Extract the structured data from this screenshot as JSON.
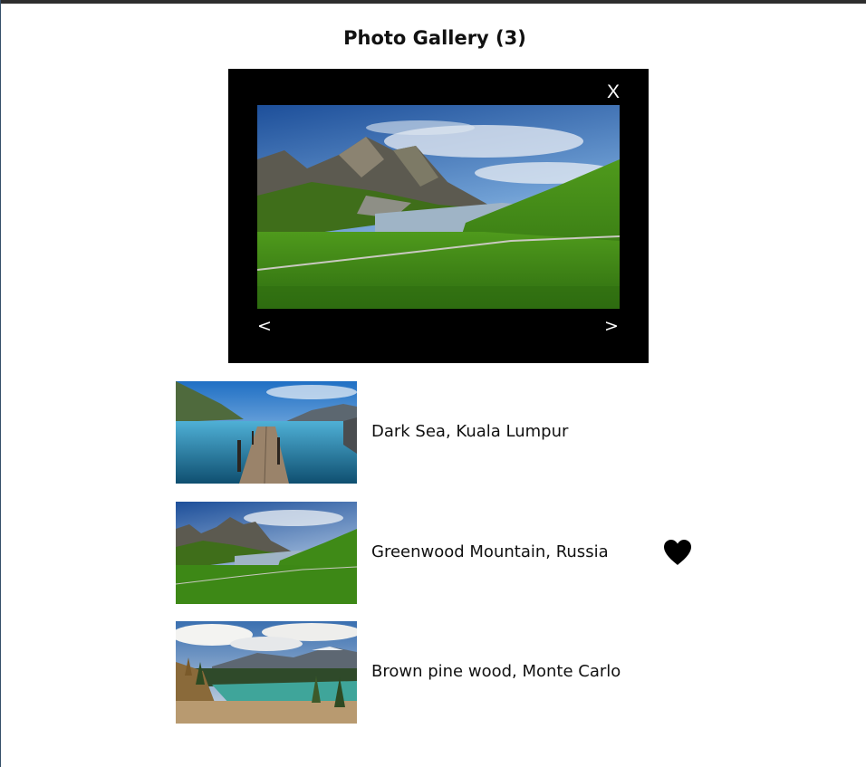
{
  "gallery": {
    "title": "Photo Gallery (3)"
  },
  "viewer": {
    "close_label": "X",
    "prev_label": "<",
    "next_label": ">",
    "current_image": "greenwood-mountain-landscape"
  },
  "photos": [
    {
      "caption": "Dark Sea, Kuala Lumpur",
      "favorite": false
    },
    {
      "caption": "Greenwood Mountain, Russia",
      "favorite": true
    },
    {
      "caption": "Brown pine wood, Monte Carlo",
      "favorite": false
    }
  ],
  "colors": {
    "viewer_background": "#000000",
    "text": "#111111",
    "heart": "#000000"
  },
  "icons": {
    "favorite": "heart-icon"
  }
}
